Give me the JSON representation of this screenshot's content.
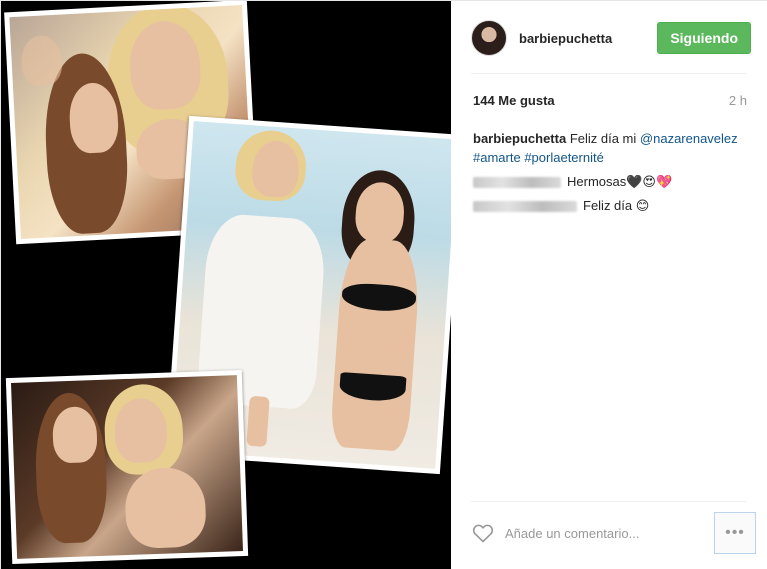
{
  "post": {
    "username": "barbiepuchetta",
    "follow_label": "Siguiendo",
    "likes": "144 Me gusta",
    "time_ago": "2 h",
    "caption": {
      "user": "barbiepuchetta",
      "text_start": "Feliz día mi",
      "mention": "@nazarenavelez",
      "hashtag1": "#amarte",
      "hashtag2": "#porlaeternité"
    },
    "comments": [
      {
        "text": "Hermosas🖤😍💖"
      },
      {
        "text": "Feliz día 😊"
      }
    ],
    "comment_placeholder": "Añade un comentario...",
    "more_label": "•••"
  },
  "colors": {
    "follow_button": "#5cb85c",
    "link": "#125688",
    "media_background": "#000000"
  },
  "icons": {
    "heart": "heart-outline-icon",
    "more": "more-options-icon"
  }
}
